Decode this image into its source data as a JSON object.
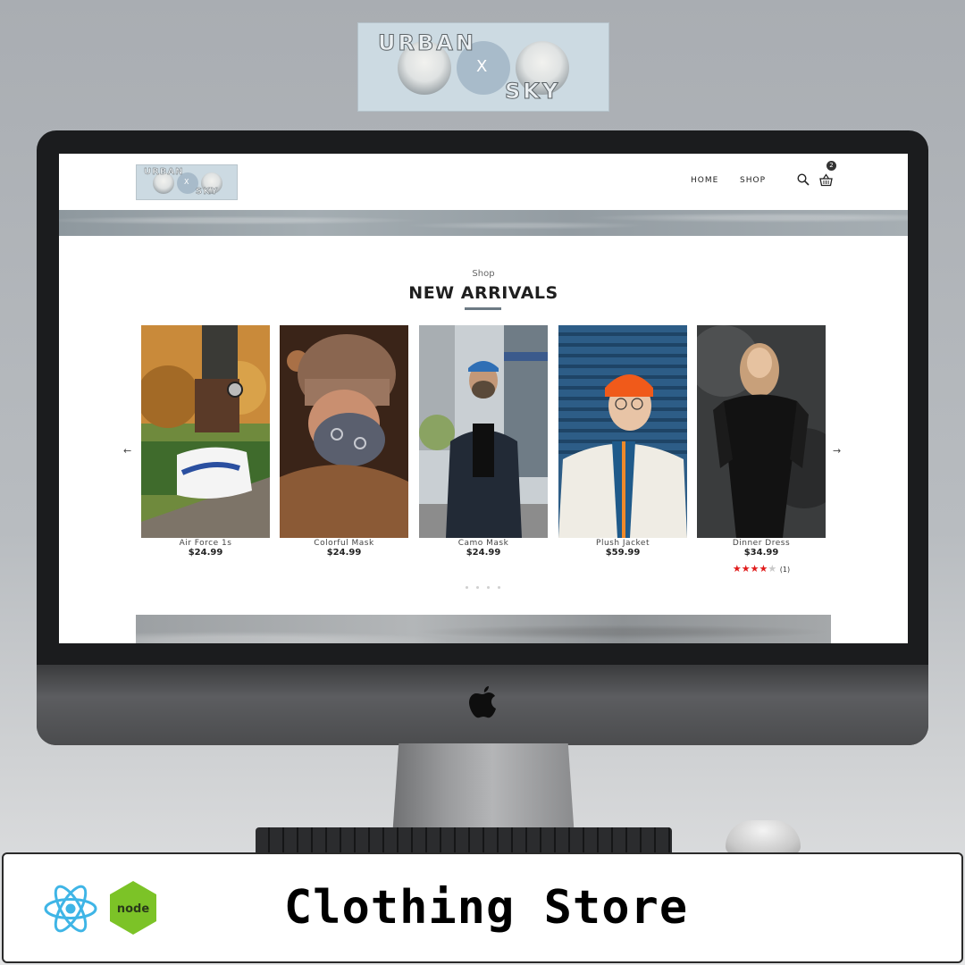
{
  "brand": {
    "logo_top": "URBAN",
    "logo_middle": "X",
    "logo_bottom": "SKY"
  },
  "site": {
    "nav": {
      "home": "HOME",
      "shop": "SHOP"
    },
    "cart_count": "2",
    "section_kicker": "Shop",
    "section_title": "NEW ARRIVALS",
    "prev_arrow": "←",
    "next_arrow": "→",
    "products": [
      {
        "name": "Air Force 1s",
        "price": "$24.99"
      },
      {
        "name": "Colorful Mask",
        "price": "$24.99"
      },
      {
        "name": "Camo Mask",
        "price": "$24.99"
      },
      {
        "name": "Plush Jacket",
        "price": "$59.99"
      },
      {
        "name": "Dinner Dress",
        "price": "$34.99",
        "rating": 4,
        "rating_max": 5,
        "review_count": "(1)"
      }
    ]
  },
  "caption": {
    "text": "Clothing Store",
    "tech_icons": [
      "react-icon",
      "node-icon"
    ]
  },
  "colors": {
    "logo_bg": "#ccdae2",
    "star_active": "#e01b1b",
    "underline": "#6d7a84"
  }
}
